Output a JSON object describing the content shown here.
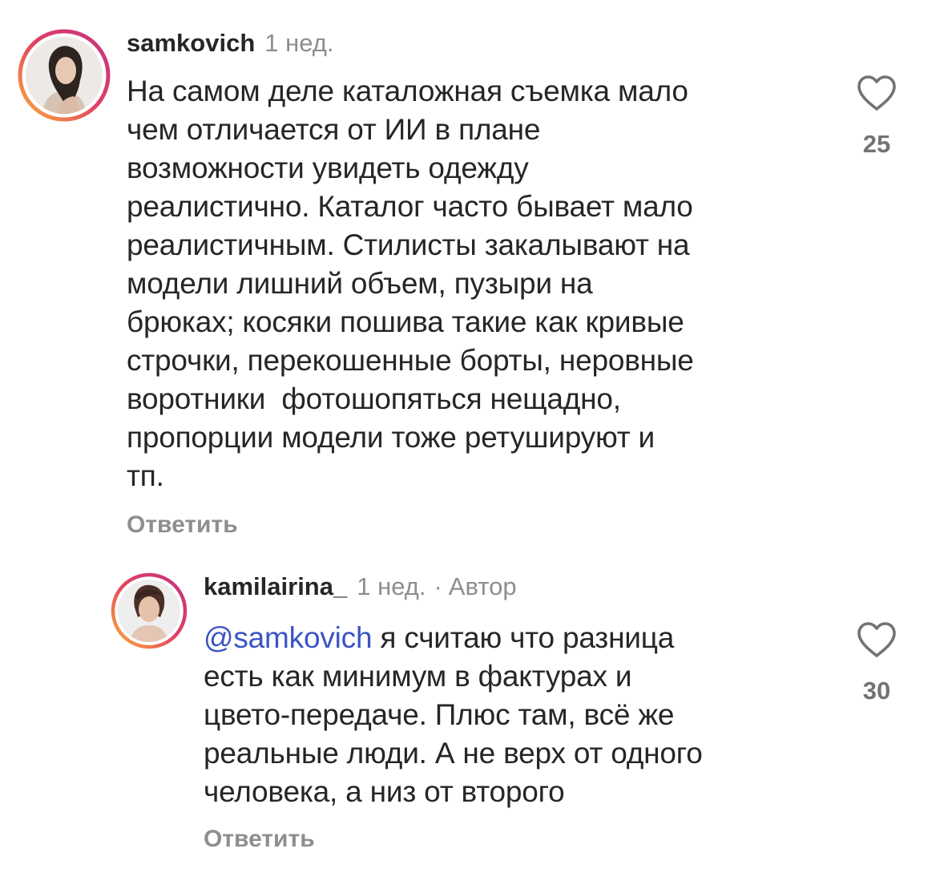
{
  "comments": [
    {
      "username": "samkovich",
      "time": "1 нед.",
      "author_tag": "",
      "mention": "",
      "lines": [
        "На самом деле каталожная съемка мало",
        "чем отличается от ИИ в плане",
        "возможности увидеть одежду",
        "реалистично. Каталог часто бывает мало",
        "реалистичным. Стилисты закалывают на",
        "модели лишний объем, пузыри на",
        "брюках; косяки пошива такие как кривые",
        "строчки, перекошенные борты, неровные",
        "воротники  фотошопяться нещадно,",
        "пропорции модели тоже ретушируют и",
        "тп."
      ],
      "reply_label": "Ответить",
      "like_count": "25",
      "icons": {
        "like": "heart-outline-icon",
        "avatar": "user-avatar"
      }
    },
    {
      "username": "kamilairina_",
      "time": "1 нед.",
      "separator": "·",
      "author_tag": "Автор",
      "mention": "@samkovich",
      "lines": [
        " я считаю что разница",
        "есть как минимум в фактурах и",
        "цвето-передаче. Плюс там, всё же",
        "реальные люди. А не верх от одного",
        "человека, а низ от второго"
      ],
      "reply_label": "Ответить",
      "like_count": "30",
      "icons": {
        "like": "heart-outline-icon",
        "avatar": "user-avatar"
      }
    }
  ],
  "colors": {
    "mention": "#3b54c4",
    "story_ring_start": "#fbb03b",
    "story_ring_end": "#d62976",
    "muted_text": "#8e8e8e"
  }
}
